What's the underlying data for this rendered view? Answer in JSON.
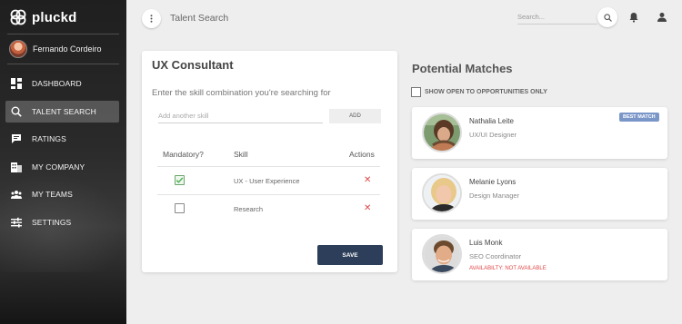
{
  "brand": {
    "name": "pluckd",
    "logo_icon": "clover-logo-icon"
  },
  "user": {
    "name": "Fernando Cordeiro"
  },
  "sidebar": {
    "items": [
      {
        "label": "DASHBOARD",
        "icon": "dashboard-icon",
        "active": false
      },
      {
        "label": "TALENT SEARCH",
        "icon": "talent-search-icon",
        "active": true
      },
      {
        "label": "RATINGS",
        "icon": "ratings-icon",
        "active": false
      },
      {
        "label": "MY COMPANY",
        "icon": "company-icon",
        "active": false
      },
      {
        "label": "MY TEAMS",
        "icon": "teams-icon",
        "active": false
      },
      {
        "label": "SETTINGS",
        "icon": "settings-icon",
        "active": false
      }
    ]
  },
  "topbar": {
    "title": "Talent Search",
    "search_placeholder": "Search..."
  },
  "form": {
    "title": "UX Consultant",
    "prompt": "Enter the skill combination you're searching for",
    "skill_placeholder": "Add another skill",
    "add_label": "ADD",
    "columns": [
      "Mandatory?",
      "Skill",
      "Actions"
    ],
    "rows": [
      {
        "skill": "UX - User Experience",
        "mandatory": true,
        "action": "✕"
      },
      {
        "skill": "Research",
        "mandatory": false,
        "action": "✕"
      }
    ],
    "save_label": "SAVE"
  },
  "matches": {
    "title": "Potential Matches",
    "filter_label": "SHOW OPEN TO OPPORTUNITIES ONLY",
    "items": [
      {
        "name": "Nathalia Leite",
        "role": "UX/UI Designer",
        "badge": "BEST MATCH"
      },
      {
        "name": "Melanie Lyons",
        "role": "Design Manager"
      },
      {
        "name": "Luis Monk",
        "role": "SEO Coordinator",
        "availability": "AVAILABILTY: NOT AVAILABLE"
      }
    ]
  },
  "colors": {
    "save_button": "#2d3e5a",
    "badge": "#7a96c8",
    "danger": "#e04848",
    "check": "#4caf50"
  }
}
